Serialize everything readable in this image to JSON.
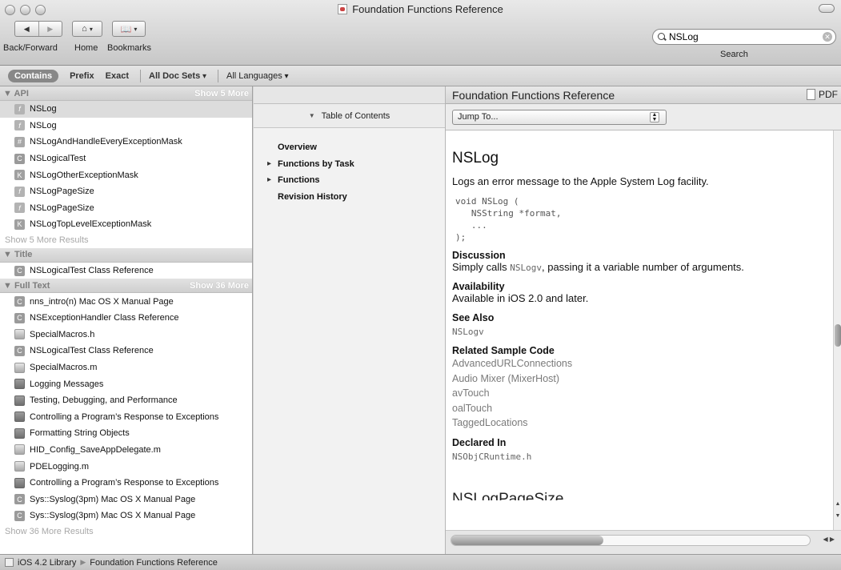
{
  "window": {
    "title": "Foundation Functions Reference"
  },
  "toolbar": {
    "back_forward_label": "Back/Forward",
    "home_label": "Home",
    "bookmarks_label": "Bookmarks",
    "search_label": "Search",
    "search_value": "NSLog",
    "icons": [
      "back-icon",
      "forward-icon",
      "home-icon",
      "bookmarks-icon",
      "search-icon",
      "clear-icon"
    ]
  },
  "scope_bar": {
    "contains": "Contains",
    "prefix": "Prefix",
    "exact": "Exact",
    "doc_sets": "All Doc Sets",
    "languages": "All Languages"
  },
  "results": {
    "api": {
      "title": "API",
      "more": "Show 5 More",
      "items": [
        {
          "badge": "f",
          "label": "NSLog"
        },
        {
          "badge": "f",
          "label": "NSLog"
        },
        {
          "badge": "#",
          "label": "NSLogAndHandleEveryExceptionMask"
        },
        {
          "badge": "C",
          "label": "NSLogicalTest"
        },
        {
          "badge": "K",
          "label": "NSLogOtherExceptionMask"
        },
        {
          "badge": "f",
          "label": "NSLogPageSize"
        },
        {
          "badge": "f",
          "label": "NSLogPageSize"
        },
        {
          "badge": "K",
          "label": "NSLogTopLevelExceptionMask"
        }
      ],
      "show_more_results": "Show 5 More Results"
    },
    "title_section": {
      "title": "Title",
      "items": [
        {
          "badge": "C",
          "label": "NSLogicalTest Class Reference"
        }
      ]
    },
    "full_text": {
      "title": "Full Text",
      "more": "Show 36 More",
      "items": [
        {
          "badge": "C",
          "label": "nns_intro(n) Mac OS X Manual Page"
        },
        {
          "badge": "C",
          "label": "NSExceptionHandler Class Reference"
        },
        {
          "badge": "h",
          "label": "SpecialMacros.h"
        },
        {
          "badge": "C",
          "label": "NSLogicalTest Class Reference"
        },
        {
          "badge": "h",
          "label": "SpecialMacros.m"
        },
        {
          "badge": "book",
          "label": "Logging Messages"
        },
        {
          "badge": "book",
          "label": "Testing, Debugging, and Performance"
        },
        {
          "badge": "book",
          "label": "Controlling a Program’s Response to Exceptions"
        },
        {
          "badge": "book",
          "label": "Formatting String Objects"
        },
        {
          "badge": "h",
          "label": "HID_Config_SaveAppDelegate.m"
        },
        {
          "badge": "h",
          "label": "PDELogging.m"
        },
        {
          "badge": "book",
          "label": "Controlling a Program’s Response to Exceptions"
        },
        {
          "badge": "C",
          "label": "Sys::Syslog(3pm) Mac OS X Manual Page"
        },
        {
          "badge": "C",
          "label": "Sys::Syslog(3pm) Mac OS X Manual Page"
        }
      ],
      "show_more_results": "Show 36 More Results"
    }
  },
  "toc": {
    "header": "Table of Contents",
    "items": [
      {
        "label": "Overview",
        "has_sub": false
      },
      {
        "label": "Functions by Task",
        "has_sub": true
      },
      {
        "label": "Functions",
        "has_sub": true
      },
      {
        "label": "Revision History",
        "has_sub": false
      }
    ]
  },
  "content": {
    "header_title": "Foundation Functions Reference",
    "pdf_label": "PDF",
    "jump_to": "Jump To...",
    "func_name": "NSLog",
    "abstract": "Logs an error message to the Apple System Log facility.",
    "declaration": "void NSLog (\n   NSString *format,\n   ...\n);",
    "discussion_heading": "Discussion",
    "discussion_pre": "Simply calls ",
    "discussion_code": "NSLogv",
    "discussion_post": ", passing it a variable number of arguments.",
    "availability_heading": "Availability",
    "availability": "Available in iOS 2.0 and later.",
    "see_also_heading": "See Also",
    "see_also": "NSLogv",
    "sample_heading": "Related Sample Code",
    "samples": [
      "AdvancedURLConnections",
      "Audio Mixer (MixerHost)",
      "avTouch",
      "oalTouch",
      "TaggedLocations"
    ],
    "declared_heading": "Declared In",
    "declared_in": "NSObjCRuntime.h",
    "next_heading": "NSLogPageSize"
  },
  "status_bar": {
    "library": "iOS 4.2 Library",
    "page": "Foundation Functions Reference"
  }
}
